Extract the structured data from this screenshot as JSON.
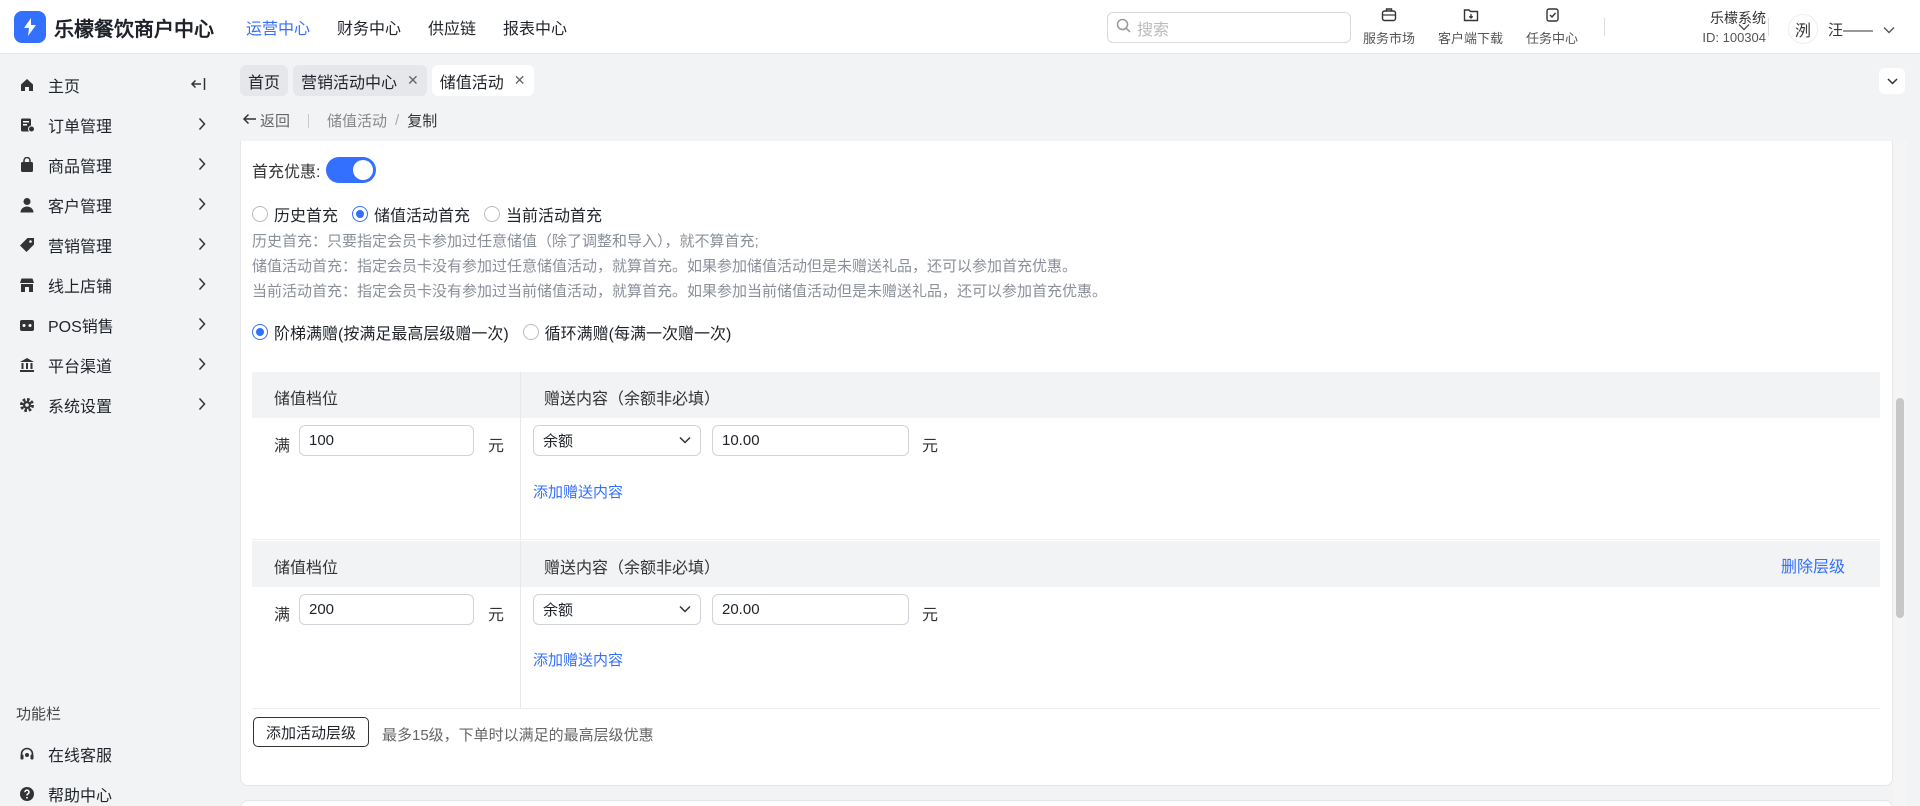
{
  "header": {
    "brand": "乐檬餐饮商户中心",
    "nav": [
      "运营中心",
      "财务中心",
      "供应链",
      "报表中心"
    ],
    "active_nav": "运营中心",
    "search_placeholder": "搜索",
    "tools": [
      "服务市场",
      "客户端下载",
      "任务中心"
    ],
    "account_name": "乐檬系统",
    "account_id": "ID: 100304",
    "avatar_text": "洌",
    "user_name": "汪——"
  },
  "sidebar": {
    "items": [
      "主页",
      "订单管理",
      "商品管理",
      "客户管理",
      "营销管理",
      "线上店铺",
      "POS销售",
      "平台渠道",
      "系统设置"
    ],
    "section_title": "功能栏",
    "footer_items": [
      "在线客服",
      "帮助中心"
    ]
  },
  "tabs": [
    {
      "label": "首页",
      "closable": false,
      "active": false
    },
    {
      "label": "营销活动中心",
      "closable": true,
      "active": false
    },
    {
      "label": "储值活动",
      "closable": true,
      "active": true
    }
  ],
  "breadcrumb": {
    "back": "返回",
    "parent": "储值活动",
    "separator": "/",
    "current": "复制"
  },
  "form": {
    "first_charge_label": "首充优惠:",
    "first_charge_enabled": true,
    "first_charge_options": [
      "历史首充",
      "储值活动首充",
      "当前活动首充"
    ],
    "first_charge_selected": 1,
    "notes": [
      "历史首充：只要指定会员卡参加过任意储值（除了调整和导入），就不算首充;",
      "储值活动首充：指定会员卡没有参加过任意储值活动，就算首充。如果参加储值活动但是未赠送礼品，还可以参加首充优惠。",
      "当前活动首充：指定会员卡没有参加过当前储值活动，就算首充。如果参加当前储值活动但是未赠送礼品，还可以参加首充优惠。"
    ],
    "gift_mode_options": [
      "阶梯满赠(按满足最高层级赠一次)",
      "循环满赠(每满一次赠一次)"
    ],
    "gift_mode_selected": 0,
    "tier_col1": "储值档位",
    "tier_col2": "赠送内容（余额非必填）",
    "full_label": "满",
    "unit": "元",
    "add_gift_link": "添加赠送内容",
    "delete_tier": "删除层级",
    "tiers": [
      {
        "threshold": "100",
        "gift_type": "余额",
        "gift_value": "10.00"
      },
      {
        "threshold": "200",
        "gift_type": "余额",
        "gift_value": "20.00"
      }
    ],
    "add_tier_button": "添加活动层级",
    "add_tier_hint": "最多15级，下单时以满足的最高层级优惠"
  },
  "colors": {
    "accent": "#3370ff",
    "bg": "#f2f3f5"
  }
}
